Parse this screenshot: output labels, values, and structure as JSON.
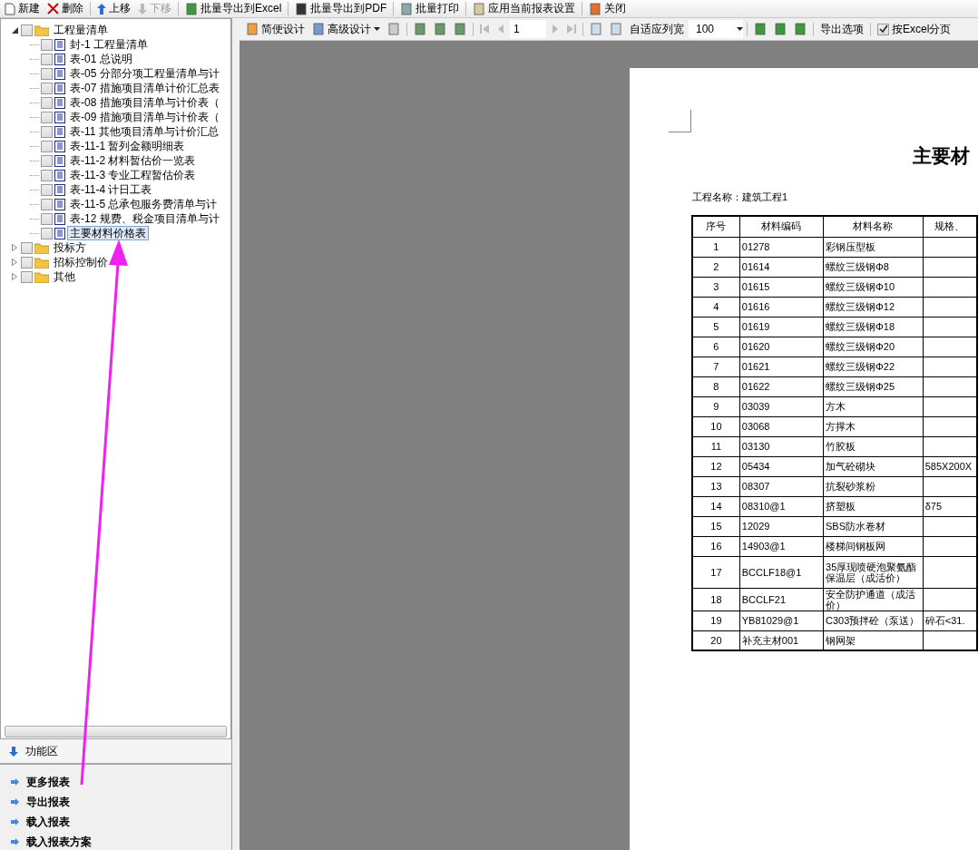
{
  "main_toolbar": [
    {
      "label": "新建",
      "disabled": false
    },
    {
      "label": "删除",
      "disabled": false
    },
    {
      "label": "上移",
      "disabled": false
    },
    {
      "label": "下移",
      "disabled": true
    },
    {
      "label": "批量导出到Excel",
      "disabled": false
    },
    {
      "label": "批量导出到PDF",
      "disabled": false
    },
    {
      "label": "批量打印",
      "disabled": false
    },
    {
      "label": "应用当前报表设置",
      "disabled": false
    },
    {
      "label": "关闭",
      "disabled": false
    }
  ],
  "tree": [
    {
      "label": "工程量清单",
      "expanded": true,
      "checked": false,
      "children": [
        {
          "label": "封-1 工程量清单",
          "checked": false,
          "selected": false
        },
        {
          "label": "表-01 总说明",
          "checked": false,
          "selected": false
        },
        {
          "label": "表-05 分部分项工程量清单与计",
          "checked": false,
          "selected": false
        },
        {
          "label": "表-07 措施项目清单计价汇总表",
          "checked": false,
          "selected": false
        },
        {
          "label": "表-08 措施项目清单与计价表（",
          "checked": false,
          "selected": false
        },
        {
          "label": "表-09 措施项目清单与计价表（",
          "checked": false,
          "selected": false
        },
        {
          "label": "表-11 其他项目清单与计价汇总",
          "checked": false,
          "selected": false
        },
        {
          "label": "表-11-1 暂列金额明细表",
          "checked": false,
          "selected": false
        },
        {
          "label": "表-11-2 材料暂估价一览表",
          "checked": false,
          "selected": false
        },
        {
          "label": "表-11-3 专业工程暂估价表",
          "checked": false,
          "selected": false
        },
        {
          "label": "表-11-4 计日工表",
          "checked": false,
          "selected": false
        },
        {
          "label": "表-11-5 总承包服务费清单与计",
          "checked": false,
          "selected": false
        },
        {
          "label": "表-12 规费、税金项目清单与计",
          "checked": false,
          "selected": false
        },
        {
          "label": "主要材料价格表",
          "checked": false,
          "selected": true
        }
      ]
    },
    {
      "label": "投标方",
      "expanded": false,
      "checked": false
    },
    {
      "label": "招标控制价",
      "expanded": false,
      "checked": false
    },
    {
      "label": "其他",
      "expanded": false,
      "checked": false
    }
  ],
  "function_area": {
    "title": "功能区",
    "links": [
      "更多报表",
      "导出报表",
      "载入报表",
      "载入报表方案"
    ]
  },
  "report_toolbar": {
    "simple_design": "简便设计",
    "advanced_design": "高级设计",
    "first_disabled": true,
    "prev_disabled": true,
    "page": "1",
    "next_disabled": true,
    "last_disabled": true,
    "fit_columns": "自适应列宽",
    "zoom": "100",
    "export_options": "导出选项",
    "excel_paging": {
      "label": "按Excel分页",
      "checked": true
    }
  },
  "report": {
    "title": "主要材",
    "project": "工程名称：建筑工程1",
    "columns": [
      "序号",
      "材料编码",
      "材料名称",
      "规格、"
    ],
    "rows": [
      [
        "1",
        "01278",
        "彩钢压型板",
        ""
      ],
      [
        "2",
        "01614",
        "螺纹三级钢Φ8",
        ""
      ],
      [
        "3",
        "01615",
        "螺纹三级钢Φ10",
        ""
      ],
      [
        "4",
        "01616",
        "螺纹三级钢Φ12",
        ""
      ],
      [
        "5",
        "01619",
        "螺纹三级钢Φ18",
        ""
      ],
      [
        "6",
        "01620",
        "螺纹三级钢Φ20",
        ""
      ],
      [
        "7",
        "01621",
        "螺纹三级钢Φ22",
        ""
      ],
      [
        "8",
        "01622",
        "螺纹三级钢Φ25",
        ""
      ],
      [
        "9",
        "03039",
        "方木",
        ""
      ],
      [
        "10",
        "03068",
        "方撑木",
        ""
      ],
      [
        "11",
        "03130",
        "竹胶板",
        ""
      ],
      [
        "12",
        "05434",
        "加气砼砌块",
        "585X200X"
      ],
      [
        "13",
        "08307",
        "抗裂砂浆粉",
        ""
      ],
      [
        "14",
        "08310@1",
        "挤塑板",
        "δ75"
      ],
      [
        "15",
        "12029",
        "SBS防水卷材",
        ""
      ],
      [
        "16",
        "14903@1",
        "楼梯间钢板网",
        ""
      ],
      [
        "17",
        "BCCLF18@1",
        "35厚现喷硬泡聚氨酯保温层（成活价）",
        ""
      ],
      [
        "18",
        "BCCLF21",
        "安全防护通道（成活价）",
        ""
      ],
      [
        "19",
        "YB81029@1",
        "C303预拌砼（泵送）",
        "碎石<31."
      ],
      [
        "20",
        "补充主材001",
        "钢网架",
        ""
      ]
    ]
  }
}
